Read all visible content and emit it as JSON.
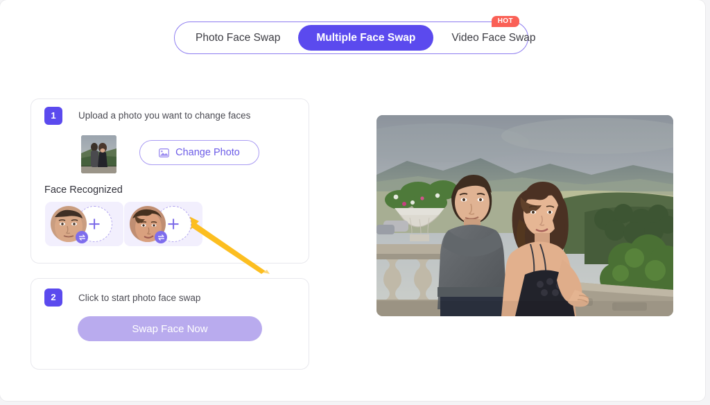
{
  "tabs": {
    "items": [
      {
        "label": "Photo Face Swap",
        "active": false,
        "badge": ""
      },
      {
        "label": "Multiple Face Swap",
        "active": true,
        "badge": ""
      },
      {
        "label": "Video Face Swap",
        "active": false,
        "badge": "HOT"
      }
    ],
    "hot_badge_label": "HOT"
  },
  "steps": {
    "one": {
      "number": "1",
      "title": "Upload a photo you want to change faces",
      "change_photo_label": "Change Photo",
      "change_photo_icon": "image-icon",
      "face_recognized_label": "Face Recognized",
      "faces": [
        {
          "name": "face-slot-male",
          "swap_icon": "swap-arrows-icon",
          "plus_icon": "plus-icon"
        },
        {
          "name": "face-slot-female",
          "swap_icon": "swap-arrows-icon",
          "plus_icon": "plus-icon"
        }
      ]
    },
    "two": {
      "number": "2",
      "title": "Click to start photo face swap",
      "button_label": "Swap Face Now"
    }
  },
  "preview": {
    "alt": "Couple standing back to back on a stone terrace overlooking green hills"
  },
  "annotation": {
    "type": "pointer-arrow",
    "color": "#fcbe20",
    "points_to": "face-slot-2-plus-circle"
  },
  "colors": {
    "accent": "#5b4aee",
    "accent_soft": "#b9abee",
    "accent_outline": "#a99bf3",
    "slot_bg": "#f2effd",
    "hot": "#fa6056",
    "arrow": "#fcbe20",
    "text": "#3c3c43",
    "page_bg": "#ffffff",
    "canvas_bg": "#f4f4f6"
  }
}
